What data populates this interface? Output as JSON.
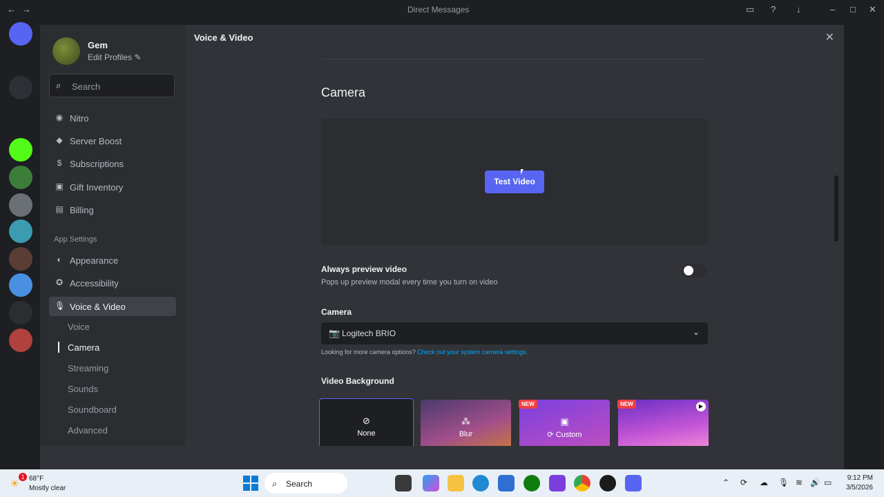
{
  "window": {
    "title": "Direct Messages"
  },
  "profile": {
    "name": "Gem",
    "edit_label": "Edit Profiles"
  },
  "search": {
    "placeholder": "Search"
  },
  "sidebar": {
    "billing_items": [
      {
        "icon": "nitro-icon",
        "label": "Nitro"
      },
      {
        "icon": "server-boost-icon",
        "label": "Server Boost"
      },
      {
        "icon": "subscriptions-icon",
        "label": "Subscriptions"
      },
      {
        "icon": "gift-icon",
        "label": "Gift Inventory"
      },
      {
        "icon": "billing-icon",
        "label": "Billing"
      }
    ],
    "app_settings_header": "App Settings",
    "app_items": [
      {
        "icon": "palette-icon",
        "label": "Appearance"
      },
      {
        "icon": "accessibility-icon",
        "label": "Accessibility"
      },
      {
        "icon": "microphone-icon",
        "label": "Voice & Video"
      }
    ],
    "sub_items": [
      "Voice",
      "Camera",
      "Streaming",
      "Sounds",
      "Soundboard",
      "Advanced"
    ],
    "active_sub": "Camera"
  },
  "page": {
    "title": "Voice & Video",
    "section_title": "Camera",
    "test_video_label": "Test Video",
    "always_preview": {
      "title": "Always preview video",
      "description": "Pops up preview modal every time you turn on video",
      "enabled": false
    },
    "camera_label": "Camera",
    "camera_value": "Logitech BRIO",
    "camera_help_text": "Looking for more camera options?",
    "camera_help_link": "Check out your system camera settings.",
    "video_background_label": "Video Background",
    "backgrounds": [
      {
        "label": "None",
        "icon": "none-icon",
        "new": false
      },
      {
        "label": "Blur",
        "icon": "blur-icon",
        "new": false
      },
      {
        "label": "Custom",
        "icon": "custom-image-icon",
        "new": true,
        "badge": "NEW"
      },
      {
        "label": "",
        "icon": "play-icon",
        "new": true,
        "badge": "NEW"
      }
    ]
  },
  "taskbar": {
    "weather_temp": "68°F",
    "weather_desc": "Mostly clear",
    "weather_badge": "1",
    "search_placeholder": "Search",
    "time": "9:12 PM",
    "date": "3/5/2026"
  },
  "colors": {
    "accent": "#5865f2",
    "link": "#00a8fc",
    "new_badge": "#f23f43"
  }
}
